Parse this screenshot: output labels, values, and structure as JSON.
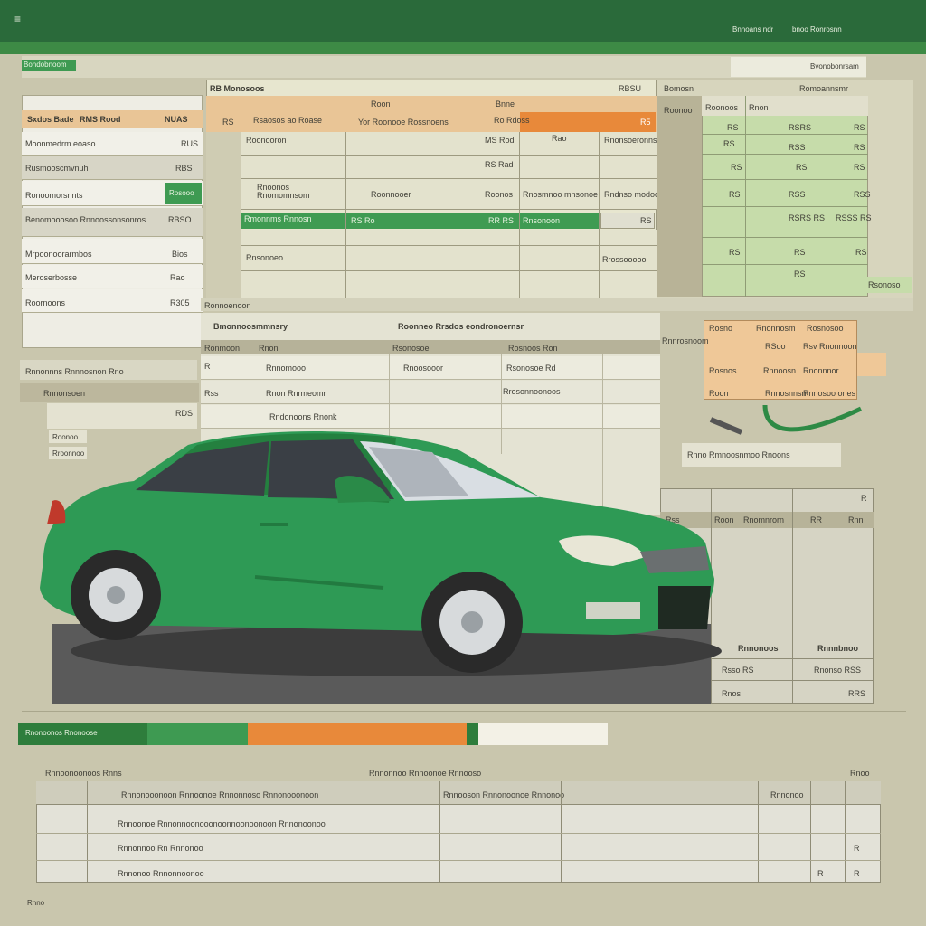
{
  "titlebar": {
    "menu_icon": "≡",
    "link1": "Bnnoans ndr",
    "link2": "bnoo Ronrosnn"
  },
  "header": {
    "breadcrumb": "Bondobnoom",
    "right_label": "Bvonobonrsam"
  },
  "left_panel": {
    "headers": [
      "Sxdos Bade",
      "RMS Rood",
      "NUAS"
    ],
    "rows": [
      {
        "label": "Moonmedrm eoaso",
        "value": "RUS"
      },
      {
        "label": "Rusmooscmvnuh",
        "value": "RBS"
      },
      {
        "label": "Ronoomorsnnts",
        "value": "Rosooo"
      },
      {
        "label": "Benomooosoo Rnnoossonsonros",
        "value": "RBSO"
      },
      {
        "label": "Mrpoonoorarmbos",
        "value": "Bios"
      },
      {
        "label": "Meroserbosse",
        "value": "Rao"
      },
      {
        "label": "Roornoons",
        "value": "R305"
      }
    ]
  },
  "main_grid": {
    "title": "RB Monosoos",
    "title_right": "RBSU",
    "top_headers": [
      "",
      "",
      "Roon",
      "Bnne",
      "",
      ""
    ],
    "orange_row": [
      "RS",
      "Rsaosos ao Roase",
      "Yor Roonooe Rossnoens",
      "Ro Rdoss",
      "",
      "R5"
    ],
    "rows": [
      [
        "",
        "Roonooron",
        "",
        "MS Rod",
        "Rao",
        "Rnonsoeronnsn"
      ],
      [
        "",
        "",
        "",
        "RS Rad",
        "",
        ""
      ],
      [
        "",
        "Rnoonos Rnomomnsom",
        "Roonnooer",
        "Roonos",
        "Rnosmnoo mnsonoe",
        "Rndnso modoos"
      ],
      [
        "",
        "Rmonnms Rnnosn",
        "RS Ro",
        "RR RS",
        "Rnsonoon",
        "RS"
      ],
      [
        "",
        "Rnsonoeo",
        "",
        "",
        "",
        "Rrossooooo"
      ]
    ],
    "footer": "Ronnoenoon"
  },
  "right_grid": {
    "top": "Bomosn",
    "top2": "Romoannsmr",
    "headers": [
      "Roonoo",
      "Roonoos",
      "Rnon"
    ],
    "rows": [
      [
        "RS",
        "RSRS",
        "RS"
      ],
      [
        "RS",
        "RSS",
        "RS"
      ],
      [
        "RS",
        "RS",
        "RS"
      ],
      [
        "RS",
        "RSS",
        "RSS"
      ],
      [
        "",
        "RSRS RS",
        "RSSS RS"
      ],
      [
        "RS",
        "RS",
        "RS"
      ],
      [
        "",
        "RS",
        ""
      ]
    ],
    "badge": "Rsonoso"
  },
  "lower_table": {
    "title_left": "Bmonnoosmmnsry",
    "title_mid": "Roonneo Rrsdos eondronoernsr",
    "headers": [
      "Ronmoon",
      "Rnon",
      "Rsonosoe",
      "Rosnoos Ron"
    ],
    "rows": [
      [
        "R",
        "Rnnomooo",
        "Rnoosooor",
        "Rsonosoe Rd"
      ],
      [
        "Rss",
        "Rnon Rnrmeomr",
        "",
        "Rrosonnoonoos"
      ],
      [
        "",
        "Rndonoons Rnonk",
        "",
        ""
      ]
    ]
  },
  "left_lower": {
    "title": "Rnnonnns Rnnnosnon Rno",
    "subtitle": "Rnnonsoen",
    "value": "RDS",
    "chip1": "Roonoo",
    "chip2": "Rroonnoo"
  },
  "callout": {
    "rows": [
      [
        "Rosno",
        "Rnonnosm",
        "Rosnosoo"
      ],
      [
        "",
        "RSoo",
        "Rsv Rnonnoon"
      ],
      [
        "Rosnos",
        "Rnnoosn",
        "Rnonnnor"
      ],
      [
        "Roon",
        "Rnnosnnsn",
        "Rnnosoo ones"
      ]
    ],
    "caption": "Rnno Rmnoosnmoo Rnoons",
    "side": "Rnnrosnoom"
  },
  "right_lower": {
    "header": "R",
    "cols": [
      "Rss",
      "Roon",
      "Rnomnrorn",
      "RR",
      "Rnn"
    ],
    "summary": [
      [
        "Rnnonoos",
        "Rnnnbnoo"
      ],
      [
        "Rsso RS",
        "Rnonso RSS"
      ],
      [
        "Rnos",
        "RRS"
      ]
    ]
  },
  "progress": {
    "label": "Rnonoonos Rnonoose",
    "segments": [
      {
        "color": "#2e7d3c",
        "pct": 0.22
      },
      {
        "color": "#3e9a52",
        "pct": 0.17
      },
      {
        "color": "#e8893a",
        "pct": 0.37
      },
      {
        "color": "#2e7d3c",
        "pct": 0.02
      },
      {
        "color": "#f3f1e6",
        "pct": 0.07
      }
    ]
  },
  "bottom_table": {
    "title_left": "Rnnoonoonoos Rnns",
    "title_mid": "Rnnonnoo Rnnoonoe Rnnooso",
    "title_right": "Rnoo",
    "headers": [
      "",
      "Rnnonooonoon Rnnoonoe Rnnonnoso Rnnonooonoon",
      "Rnnooson Rnnonoonoe Rnnonoo",
      "",
      "Rnnonoo",
      ""
    ],
    "rows": [
      [
        "",
        "Rnnoonoe Rnnonnoonooonoonnoonoonoon Rnnonoonoo",
        "",
        "",
        "",
        ""
      ],
      [
        "",
        "Rnnonnoo Rn Rnnonoo",
        "",
        "",
        "",
        "R"
      ],
      [
        "",
        "Rnnonoo Rnnonnoonoo",
        "",
        "",
        "R",
        "R"
      ]
    ],
    "footer": "Rnno"
  },
  "colors": {
    "topbar": "#2a6a3a",
    "accent_green": "#3e9a52",
    "accent_orange": "#e8893a",
    "car": "#2e9a55"
  }
}
